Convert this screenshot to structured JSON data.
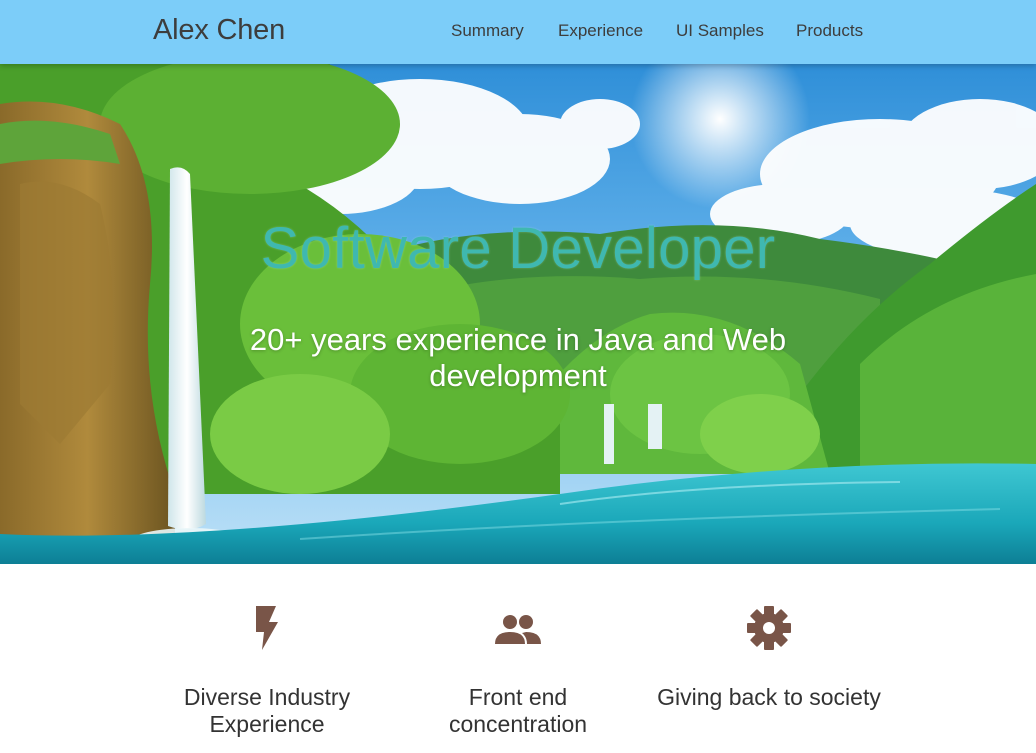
{
  "header": {
    "brand": "Alex Chen",
    "nav": [
      "Summary",
      "Experience",
      "UI Samples",
      "Products"
    ]
  },
  "hero": {
    "title": "Software Developer",
    "subtitle": "20+ years experience in Java and Web development"
  },
  "features": [
    {
      "icon": "flash-icon",
      "label": "Diverse Industry Experience"
    },
    {
      "icon": "people-icon",
      "label": "Front end concentration"
    },
    {
      "icon": "gear-icon",
      "label": "Giving back to society"
    }
  ],
  "colors": {
    "navbar": "#7ccdf9",
    "title": "#3fb8b0",
    "icon": "#795548",
    "text": "#333333"
  }
}
